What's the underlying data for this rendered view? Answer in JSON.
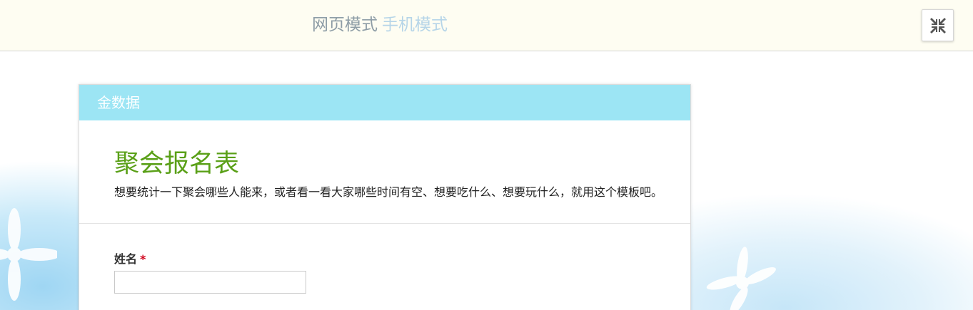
{
  "topbar": {
    "web_mode_label": "网页模式",
    "mobile_mode_label": "手机模式",
    "collapse_icon": "collapse-arrows-icon"
  },
  "form": {
    "brand": "金数据",
    "title": "聚会报名表",
    "description": "想要统计一下聚会哪些人能来，或者看一看大家哪些时间有空、想要吃什么、想要玩什么，就用这个模板吧。",
    "fields": [
      {
        "label": "姓名",
        "required_mark": "*",
        "value": ""
      }
    ]
  },
  "colors": {
    "header_bg": "#9ce5f4",
    "title_green": "#5aa018",
    "required_red": "#d0021b",
    "topbar_bg": "#fefdf2"
  }
}
